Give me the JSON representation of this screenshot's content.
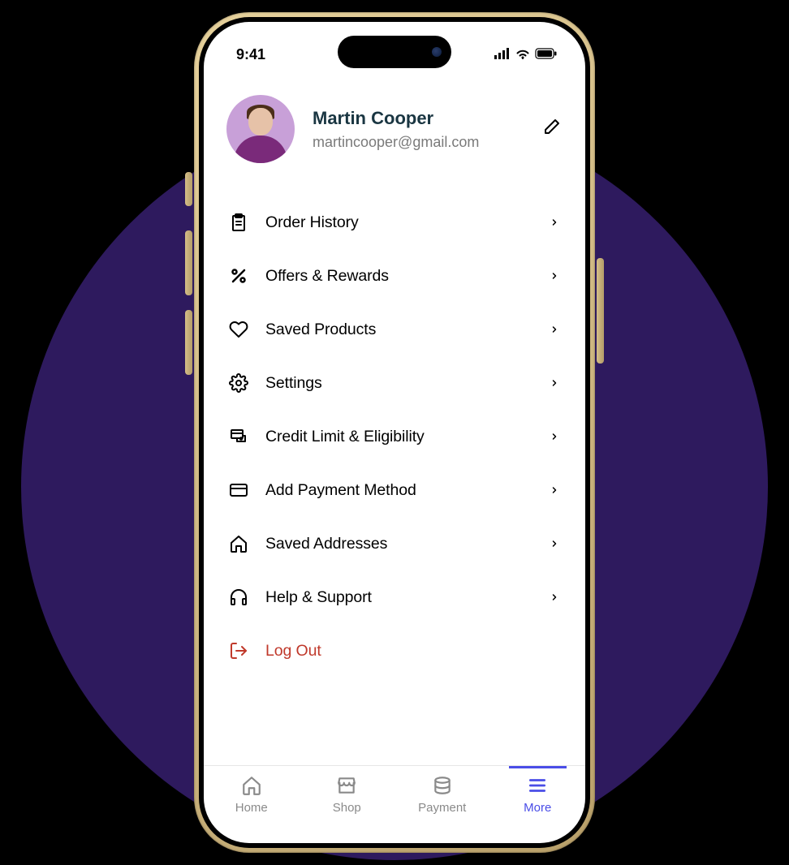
{
  "status": {
    "time": "9:41"
  },
  "profile": {
    "name": "Martin Cooper",
    "email": "martincooper@gmail.com"
  },
  "menu": [
    {
      "label": "Order History",
      "icon": "clipboard-icon",
      "chevron": true,
      "danger": false
    },
    {
      "label": "Offers & Rewards",
      "icon": "percent-icon",
      "chevron": true,
      "danger": false
    },
    {
      "label": "Saved Products",
      "icon": "heart-icon",
      "chevron": true,
      "danger": false
    },
    {
      "label": "Settings",
      "icon": "gear-icon",
      "chevron": true,
      "danger": false
    },
    {
      "label": "Credit Limit & Eligibility",
      "icon": "credit-icon",
      "chevron": true,
      "danger": false
    },
    {
      "label": "Add Payment Method",
      "icon": "card-icon",
      "chevron": true,
      "danger": false
    },
    {
      "label": "Saved Addresses",
      "icon": "home-icon",
      "chevron": true,
      "danger": false
    },
    {
      "label": "Help & Support",
      "icon": "headphones-icon",
      "chevron": true,
      "danger": false
    },
    {
      "label": "Log Out",
      "icon": "logout-icon",
      "chevron": false,
      "danger": true
    }
  ],
  "tabs": [
    {
      "label": "Home",
      "icon": "home-icon",
      "active": false
    },
    {
      "label": "Shop",
      "icon": "shop-icon",
      "active": false
    },
    {
      "label": "Payment",
      "icon": "payment-icon",
      "active": false
    },
    {
      "label": "More",
      "icon": "menu-icon",
      "active": true
    }
  ],
  "colors": {
    "accent": "#4a4de7",
    "danger": "#c0392b",
    "background_circle": "#2e1a5e"
  }
}
